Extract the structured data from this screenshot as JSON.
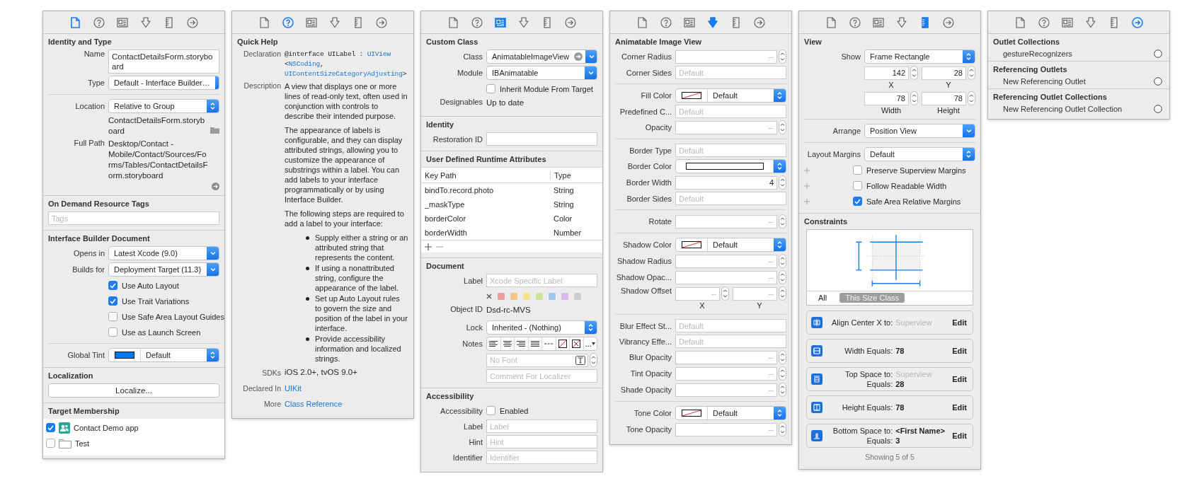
{
  "inspectors": [
    {
      "tabs": [
        {
          "kind": "file",
          "selected": true
        },
        {
          "kind": "help",
          "selected": false
        },
        {
          "kind": "identity",
          "selected": false
        },
        {
          "kind": "attributes",
          "selected": false
        },
        {
          "kind": "size",
          "selected": false
        },
        {
          "kind": "connections",
          "selected": false
        }
      ],
      "sections": [
        {
          "title": "Identity and Type",
          "rows": [
            {
              "kind": "text-area",
              "label": "Name",
              "value": "ContactDetailsForm.storyboard"
            },
            {
              "kind": "popup",
              "label": "Type",
              "value": "Default - Interface Builder…"
            },
            {
              "kind": "divider"
            },
            {
              "kind": "popup",
              "label": "Location",
              "value": "Relative to Group"
            },
            {
              "kind": "text-folder",
              "value": "ContactDetailsForm.storyboard"
            },
            {
              "kind": "text-reveal",
              "label": "Full Path",
              "value": "Desktop/Contact - Mobile/Contact/Sources/Forms/Tables/ContactDetailsForm.storyboard"
            }
          ]
        },
        {
          "title": "On Demand Resource Tags",
          "rows": [
            {
              "kind": "tags-field",
              "placeholder": "Tags"
            }
          ]
        },
        {
          "title": "Interface Builder Document",
          "rows": [
            {
              "kind": "pulldown",
              "label": "Opens in",
              "value": "Latest Xcode (9.0)"
            },
            {
              "kind": "pulldown",
              "label": "Builds for",
              "value": "Deployment Target (11.3)"
            },
            {
              "kind": "checkbox",
              "text": "Use Auto Layout",
              "checked": true
            },
            {
              "kind": "checkbox",
              "text": "Use Trait Variations",
              "checked": true
            },
            {
              "kind": "checkbox",
              "text": "Use Safe Area Layout Guides",
              "checked": false
            },
            {
              "kind": "checkbox",
              "text": "Use as Launch Screen",
              "checked": false
            },
            {
              "kind": "divider"
            },
            {
              "kind": "color-popup",
              "label": "Global Tint",
              "value": "Default",
              "color": "#0a78f0"
            }
          ]
        },
        {
          "title": "Localization",
          "rows": [
            {
              "kind": "button",
              "text": "Localize..."
            }
          ]
        },
        {
          "title": "Target Membership",
          "rows": [
            {
              "kind": "members",
              "items": [
                {
                  "kind": "app",
                  "text": "Contact Demo app",
                  "checked": true
                },
                {
                  "kind": "folder",
                  "text": "Test",
                  "checked": false
                }
              ]
            }
          ]
        }
      ]
    },
    {
      "tabs": [
        {
          "kind": "file",
          "selected": false
        },
        {
          "kind": "help",
          "selected": true
        },
        {
          "kind": "identity",
          "selected": false
        },
        {
          "kind": "attributes",
          "selected": false
        },
        {
          "kind": "size",
          "selected": false
        },
        {
          "kind": "connections",
          "selected": false
        }
      ],
      "sections": [
        {
          "title": "Quick Help",
          "rows": [
            {
              "kind": "code",
              "label": "Declaration",
              "parts": [
                {
                  "text": "@interface UILabel : ",
                  "link": false
                },
                {
                  "text": "UIView",
                  "link": true
                },
                {
                  "text": " <",
                  "link": false
                },
                {
                  "text": "NSCoding",
                  "link": true
                },
                {
                  "text": ", ",
                  "link": false
                },
                {
                  "text": "UIContentSizeCategoryAdjusting",
                  "link": true
                },
                {
                  "text": ">",
                  "link": false
                }
              ]
            },
            {
              "kind": "help-text",
              "label": "Description",
              "paragraphs": [
                "A view that displays one or more lines of read-only text, often used in conjunction with controls to describe their intended purpose.",
                "The appearance of labels is configurable, and they can display attributed strings, allowing you to customize the appearance of substrings within a label. You can add labels to your interface programmatically or by using Interface Builder.",
                "The following steps are required to add a label to your interface:"
              ],
              "bullets": [
                "Supply either a string or an attributed string that represents the content.",
                "If using a nonattributed string, configure the appearance of the label.",
                "Set up Auto Layout rules to govern the size and position of the label in your interface.",
                "Provide accessibility information and localized strings."
              ]
            },
            {
              "kind": "help-info",
              "label": "SDKs",
              "value": "iOS 2.0+, tvOS 9.0+"
            },
            {
              "kind": "help-link",
              "label": "Declared In",
              "value": "UIKit"
            },
            {
              "kind": "help-link",
              "label": "More",
              "value": "Class Reference"
            }
          ]
        }
      ]
    },
    {
      "tabs": [
        {
          "kind": "file",
          "selected": false
        },
        {
          "kind": "help",
          "selected": false
        },
        {
          "kind": "identity",
          "selected": true
        },
        {
          "kind": "attributes",
          "selected": false
        },
        {
          "kind": "size",
          "selected": false
        },
        {
          "kind": "connections",
          "selected": false
        }
      ],
      "sections": [
        {
          "title": "Custom Class",
          "rows": [
            {
              "kind": "combo",
              "label": "Class",
              "value": "AnimatableImageView"
            },
            {
              "kind": "pulldown",
              "label": "Module",
              "value": "IBAnimatable"
            },
            {
              "kind": "checkbox",
              "text": "Inherit Module From Target",
              "checked": false
            },
            {
              "kind": "text",
              "label": "Designables",
              "value": "Up to date"
            }
          ]
        },
        {
          "title": "Identity",
          "rows": [
            {
              "kind": "field",
              "label": "Restoration ID"
            }
          ]
        },
        {
          "title": "User Defined Runtime Attributes",
          "rows": [
            {
              "kind": "table",
              "columns": [
                "Key Path",
                "Type"
              ],
              "rows": [
                [
                  "bindTo.record.photo",
                  "String"
                ],
                [
                  "_maskType",
                  "String"
                ],
                [
                  "borderColor",
                  "Color"
                ],
                [
                  "borderWidth",
                  "Number"
                ]
              ]
            }
          ]
        },
        {
          "title": "Document",
          "rows": [
            {
              "kind": "field",
              "label": "Label",
              "placeholder": "Xcode Specific Label"
            },
            {
              "kind": "label-colors",
              "colors": [
                {
                  "color": "#f29b9b"
                },
                {
                  "color": "#f7c488"
                },
                {
                  "color": "#f3e38a"
                },
                {
                  "color": "#cde597"
                },
                {
                  "color": "#9dc9f2"
                },
                {
                  "color": "#d5b9ef"
                },
                {
                  "color": "#cfcfcf"
                }
              ]
            },
            {
              "kind": "text",
              "label": "Object ID",
              "value": "Dsd-rc-MVS"
            },
            {
              "kind": "popup",
              "label": "Lock",
              "value": "Inherited - (Nothing)"
            },
            {
              "kind": "notes-toolbar",
              "label": "Notes",
              "more": "..."
            },
            {
              "kind": "font-field",
              "placeholder": "No Font"
            },
            {
              "kind": "field",
              "placeholder": "Comment For Localizer"
            }
          ]
        },
        {
          "title": "Accessibility",
          "rows": [
            {
              "kind": "checkbox",
              "label": "Accessibility",
              "text": "Enabled",
              "checked": false
            },
            {
              "kind": "field",
              "label": "Label",
              "placeholder": "Label"
            },
            {
              "kind": "field",
              "label": "Hint",
              "placeholder": "Hint"
            },
            {
              "kind": "field",
              "label": "Identifier",
              "placeholder": "Identifier"
            }
          ]
        }
      ]
    },
    {
      "tabs": [
        {
          "kind": "file",
          "selected": false
        },
        {
          "kind": "help",
          "selected": false
        },
        {
          "kind": "identity",
          "selected": false
        },
        {
          "kind": "attributes",
          "selected": true
        },
        {
          "kind": "size",
          "selected": false
        },
        {
          "kind": "connections",
          "selected": false
        }
      ],
      "sections": [
        {
          "title": "Animatable Image View",
          "rows": [
            {
              "kind": "stepper",
              "label": "Corner Radius",
              "placeholder": "--"
            },
            {
              "kind": "field",
              "label": "Corner Sides",
              "placeholder": "Default"
            },
            {
              "kind": "divider"
            },
            {
              "kind": "color-popup",
              "label": "Fill Color",
              "value": "Default"
            },
            {
              "kind": "field",
              "label": "Predefined C...",
              "placeholder": "Default"
            },
            {
              "kind": "stepper",
              "label": "Opacity",
              "placeholder": "--"
            },
            {
              "kind": "divider"
            },
            {
              "kind": "field",
              "label": "Border Type",
              "placeholder": "Default"
            },
            {
              "kind": "color-well",
              "label": "Border Color",
              "color": "#ffffff"
            },
            {
              "kind": "stepper",
              "label": "Border Width",
              "value": "4"
            },
            {
              "kind": "field",
              "label": "Border Sides",
              "placeholder": "Default"
            },
            {
              "kind": "divider"
            },
            {
              "kind": "stepper",
              "label": "Rotate",
              "placeholder": "--"
            },
            {
              "kind": "divider"
            },
            {
              "kind": "color-popup",
              "label": "Shadow Color",
              "value": "Default"
            },
            {
              "kind": "stepper",
              "label": "Shadow Radius",
              "placeholder": "--"
            },
            {
              "kind": "stepper",
              "label": "Shadow Opac...",
              "placeholder": "--"
            },
            {
              "kind": "pair",
              "label": "Shadow Offset",
              "items": [
                {
                  "placeholder": "--",
                  "caption": "X"
                },
                {
                  "placeholder": "--",
                  "caption": "Y"
                }
              ]
            },
            {
              "kind": "divider"
            },
            {
              "kind": "field",
              "label": "Blur Effect St...",
              "placeholder": "Default"
            },
            {
              "kind": "field",
              "label": "Vibrancy Effe...",
              "placeholder": "Default"
            },
            {
              "kind": "stepper",
              "label": "Blur Opacity",
              "placeholder": "--"
            },
            {
              "kind": "stepper",
              "label": "Tint Opacity",
              "placeholder": "--"
            },
            {
              "kind": "stepper",
              "label": "Shade Opacity",
              "placeholder": "--"
            },
            {
              "kind": "divider"
            },
            {
              "kind": "color-popup",
              "label": "Tone Color",
              "value": "Default"
            },
            {
              "kind": "stepper",
              "label": "Tone Opacity",
              "placeholder": "--"
            }
          ]
        }
      ]
    },
    {
      "tabs": [
        {
          "kind": "file",
          "selected": false
        },
        {
          "kind": "help",
          "selected": false
        },
        {
          "kind": "identity",
          "selected": false
        },
        {
          "kind": "attributes",
          "selected": false
        },
        {
          "kind": "size",
          "selected": true
        },
        {
          "kind": "connections",
          "selected": false
        }
      ],
      "sections": [
        {
          "title": "View",
          "rows": [
            {
              "kind": "popup",
              "label": "Show",
              "value": "Frame Rectangle"
            },
            {
              "kind": "pair",
              "items": [
                {
                  "value": "142",
                  "caption": "X"
                },
                {
                  "value": "28",
                  "caption": "Y"
                }
              ]
            },
            {
              "kind": "pair",
              "items": [
                {
                  "value": "78",
                  "caption": "Width"
                },
                {
                  "value": "78",
                  "caption": "Height"
                }
              ]
            },
            {
              "kind": "divider"
            },
            {
              "kind": "pulldown",
              "label": "Arrange",
              "value": "Position View"
            },
            {
              "kind": "divider"
            },
            {
              "kind": "popup",
              "label": "Layout Margins",
              "value": "Default"
            },
            {
              "kind": "margin-checkbox",
              "text": "Preserve Superview Margins",
              "checked": false
            },
            {
              "kind": "margin-checkbox",
              "text": "Follow Readable Width",
              "checked": false
            },
            {
              "kind": "margin-checkbox",
              "text": "Safe Area Relative Margins",
              "checked": true
            }
          ]
        },
        {
          "title": "Constraints",
          "rows": [
            {
              "kind": "constraint-canvas",
              "tabs": [
                {
                  "label": "All",
                  "selected": false
                },
                {
                  "label": "This Size Class",
                  "selected": true
                }
              ]
            },
            {
              "kind": "constraints",
              "items": [
                {
                  "kind": "center-x",
                  "action": "Edit",
                  "lines": [
                    {
                      "label": "Align Center X to:",
                      "value": "Superview",
                      "muted": true
                    }
                  ]
                },
                {
                  "kind": "width",
                  "action": "Edit",
                  "lines": [
                    {
                      "label": "Width Equals:",
                      "value": "78",
                      "muted": false
                    }
                  ]
                },
                {
                  "kind": "top",
                  "action": "Edit",
                  "lines": [
                    {
                      "label": "Top Space to:",
                      "value": "Superview",
                      "muted": true
                    },
                    {
                      "label": "Equals:",
                      "value": "28",
                      "muted": false
                    }
                  ]
                },
                {
                  "kind": "height",
                  "action": "Edit",
                  "lines": [
                    {
                      "label": "Height Equals:",
                      "value": "78",
                      "muted": false
                    }
                  ]
                },
                {
                  "kind": "bottom",
                  "action": "Edit",
                  "lines": [
                    {
                      "label": "Bottom Space to:",
                      "value": "<First Name>",
                      "muted": false
                    },
                    {
                      "label": "Equals:",
                      "value": "3",
                      "muted": false
                    }
                  ]
                }
              ]
            },
            {
              "kind": "caption",
              "text": "Showing 5 of 5"
            }
          ]
        }
      ]
    },
    {
      "tabs": [
        {
          "kind": "file",
          "selected": false
        },
        {
          "kind": "help",
          "selected": false
        },
        {
          "kind": "identity",
          "selected": false
        },
        {
          "kind": "attributes",
          "selected": false
        },
        {
          "kind": "size",
          "selected": false
        },
        {
          "kind": "connections",
          "selected": true
        }
      ],
      "sections": [
        {
          "title": "Outlet Collections",
          "rows": [
            {
              "kind": "outlet",
              "text": "gestureRecognizers"
            }
          ]
        },
        {
          "title": "Referencing Outlets",
          "rows": [
            {
              "kind": "outlet",
              "text": "New Referencing Outlet"
            }
          ]
        },
        {
          "title": "Referencing Outlet Collections",
          "rows": [
            {
              "kind": "outlet",
              "text": "New Referencing Outlet Collection"
            }
          ]
        }
      ]
    }
  ]
}
